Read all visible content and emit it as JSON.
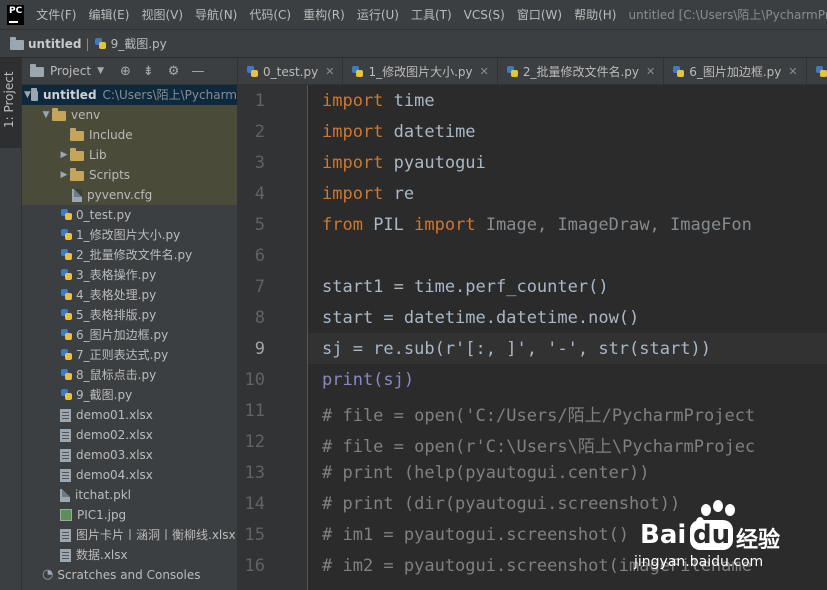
{
  "menubar": {
    "logo": "PC",
    "items": [
      "文件(F)",
      "编辑(E)",
      "视图(V)",
      "导航(N)",
      "代码(C)",
      "重构(R)",
      "运行(U)",
      "工具(T)",
      "VCS(S)",
      "窗口(W)",
      "帮助(H)"
    ],
    "window_title": "untitled [C:\\Users\\陌上\\PycharmProjects"
  },
  "breadcrumb": {
    "project": "untitled",
    "file": "9_截图.py"
  },
  "sidebar_tab": "1: Project",
  "project_panel": {
    "title": "Project",
    "icons": [
      "crosshair-icon",
      "collapse-icon",
      "gear-icon",
      "hide-icon"
    ],
    "root": {
      "name": "untitled",
      "path": "C:\\Users\\陌上\\Pycharm"
    },
    "venv": "venv",
    "venv_children": [
      "Include",
      "Lib",
      "Scripts",
      "pyvenv.cfg"
    ],
    "files": [
      "0_test.py",
      "1_修改图片大小.py",
      "2_批量修改文件名.py",
      "3_表格操作.py",
      "4_表格处理.py",
      "5_表格排版.py",
      "6_图片加边框.py",
      "7_正则表达式.py",
      "8_鼠标点击.py",
      "9_截图.py",
      "demo01.xlsx",
      "demo02.xlsx",
      "demo03.xlsx",
      "demo04.xlsx",
      "itchat.pkl",
      "PIC1.jpg",
      "图片卡片丨涵洞丨衡柳线.xlsx",
      "数据.xlsx"
    ],
    "scratches": "Scratches and Consoles"
  },
  "editor_tabs": [
    "0_test.py",
    "1_修改图片大小.py",
    "2_批量修改文件名.py",
    "6_图片加边框.py",
    "7_"
  ],
  "editor": {
    "line_numbers": [
      "1",
      "2",
      "3",
      "4",
      "5",
      "6",
      "7",
      "8",
      "9",
      "10",
      "11",
      "12",
      "13",
      "14",
      "15",
      "16"
    ],
    "lines": [
      {
        "kw": "import",
        "rest": " time"
      },
      {
        "kw": "import",
        "rest": " datetime"
      },
      {
        "kw": "import",
        "rest": " pyautogui"
      },
      {
        "kw": "import",
        "rest": " re"
      },
      {
        "kw": "from",
        "rest": " PIL ",
        "kw2": "import",
        "rest2": " Image, ImageDraw, ImageFon"
      },
      {
        "rest": ""
      },
      {
        "rest": "start1 = time.perf_counter()"
      },
      {
        "rest": "start = datetime.datetime.now()"
      },
      {
        "rest": "sj = re.sub(r'[:, ]', '-', str(start))"
      },
      {
        "rest": "print(sj)"
      },
      {
        "comment": "# file = open('C:/Users/陌上/PycharmProject"
      },
      {
        "comment": "# file = open(r'C:\\Users\\陌上\\PycharmProjec"
      },
      {
        "comment": "# print (help(pyautogui.center))"
      },
      {
        "comment": "# print (dir(pyautogui.screenshot))"
      },
      {
        "comment": "# im1 = pyautogui.screenshot()"
      },
      {
        "comment": "# im2 = pyautogui.screenshot(imageFilename"
      }
    ]
  },
  "watermark": {
    "logo": "Bai",
    "logo_mid": "du",
    "cn": "经验",
    "url": "jingyan.baidu.com"
  }
}
